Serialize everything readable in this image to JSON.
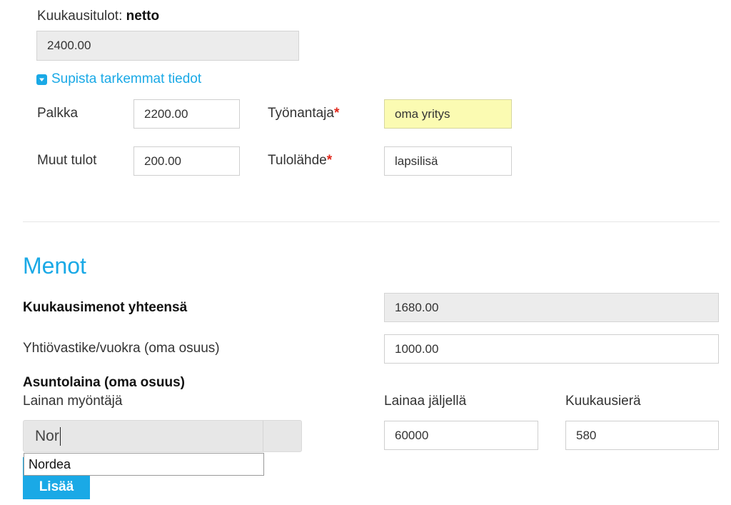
{
  "income": {
    "monthly_label": "Kuukausitulot: ",
    "monthly_label_bold": "netto",
    "monthly_value": "2400.00",
    "toggle_label": "Supista tarkemmat tiedot",
    "salary_label": "Palkka",
    "salary_value": "2200.00",
    "employer_label": "Työnantaja",
    "employer_value": "oma yritys",
    "other_label": "Muut tulot",
    "other_value": "200.00",
    "source_label": "Tulolähde",
    "source_value": "lapsilisä",
    "required_mark": "*"
  },
  "expenses": {
    "title": "Menot",
    "total_label": "Kuukausimenot yhteensä",
    "total_value": "1680.00",
    "rent_label": "Yhtiövastike/vuokra (oma osuus)",
    "rent_value": "1000.00",
    "mortgage_heading": "Asuntolaina (oma osuus)",
    "lender_label": "Lainan myöntäjä",
    "lender_input_value": "Nor",
    "lender_suggestion": "Nordea",
    "remaining_label": "Lainaa jäljellä",
    "remaining_value": "60000",
    "installment_label": "Kuukausierä",
    "installment_value": "580",
    "add_button_label": "Lisää"
  },
  "colors": {
    "accent": "#1aa9e6",
    "required": "#e0261a",
    "highlight": "#fbfbb2",
    "readonly": "#ececec"
  },
  "icons": {
    "toggle": "chevron-down-square-icon"
  }
}
